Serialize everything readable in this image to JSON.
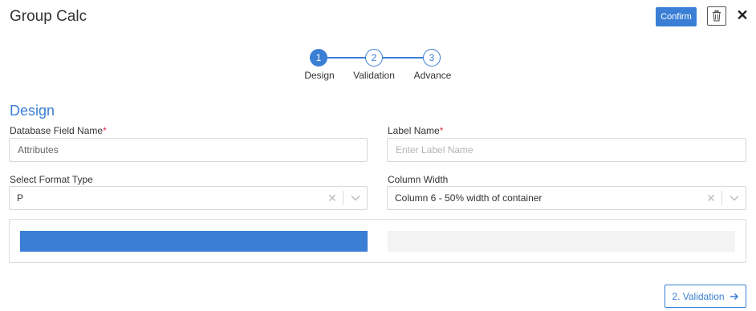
{
  "header": {
    "title": "Group Calc",
    "confirm_label": "Confirm",
    "delete_icon": "trash-icon",
    "close_label": "✕"
  },
  "stepper": {
    "steps": [
      {
        "number": "1",
        "label": "Design",
        "active": true
      },
      {
        "number": "2",
        "label": "Validation",
        "active": false
      },
      {
        "number": "3",
        "label": "Advance",
        "active": false
      }
    ]
  },
  "section": {
    "title": "Design"
  },
  "form": {
    "db_field": {
      "label": "Database Field Name",
      "required_mark": "*",
      "value": "Attributes"
    },
    "label_name": {
      "label": "Label Name",
      "required_mark": "*",
      "value": "",
      "placeholder": "Enter Label Name"
    },
    "format_type": {
      "label": "Select Format Type",
      "value": "P",
      "clear": "✕"
    },
    "column_width": {
      "label": "Column Width",
      "value": "Column 6 - 50% width of container",
      "clear": "✕"
    }
  },
  "footer": {
    "next_label": "2. Validation",
    "next_icon": "arrow-right-icon"
  },
  "colors": {
    "accent": "#3a7fd5",
    "required": "#d9304f"
  }
}
